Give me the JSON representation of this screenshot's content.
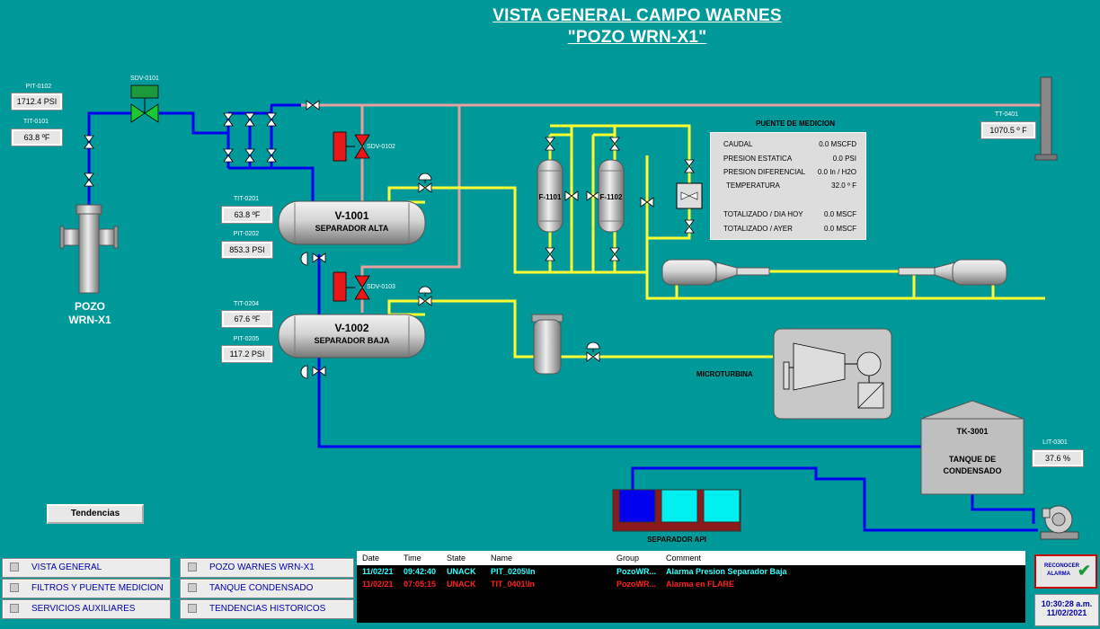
{
  "header": {
    "title_line1": "VISTA GENERAL CAMPO WARNES",
    "title_line2": "\"POZO WRN-X1\""
  },
  "instruments": {
    "pit_0102": {
      "tag": "PIT-0102",
      "value": "1712.4 PSI"
    },
    "tit_0101": {
      "tag": "TIT-0101",
      "value": "63.8 ºF"
    },
    "sdv_0101": {
      "tag": "SDV-0101"
    },
    "sdv_0102": {
      "tag": "SDV-0102"
    },
    "sdv_0103": {
      "tag": "SDV-0103"
    },
    "tit_0201": {
      "tag": "TIT-0201",
      "value": "63.8 ºF"
    },
    "pit_0202": {
      "tag": "PIT-0202",
      "value": "853.3 PSI"
    },
    "tit_0204": {
      "tag": "TIT-0204",
      "value": "67.6 ºF"
    },
    "pit_0205": {
      "tag": "PIT-0205",
      "value": "117.2 PSI"
    },
    "tt_0401": {
      "tag": "TT-0401",
      "value": "1070.5 º F"
    },
    "lit_0301": {
      "tag": "LIT-0301",
      "value": "37.6 %"
    }
  },
  "equipment": {
    "well": {
      "name": "POZO\nWRN-X1",
      "line1": "POZO",
      "line2": "WRN-X1"
    },
    "v1001": {
      "id": "V-1001",
      "name": "SEPARADOR ALTA"
    },
    "v1002": {
      "id": "V-1002",
      "name": "SEPARADOR BAJA"
    },
    "f1101": {
      "id": "F-1101"
    },
    "f1102": {
      "id": "F-1102"
    },
    "microturbine": {
      "name": "MICROTURBINA"
    },
    "tank": {
      "id": "TK-3001",
      "line1": "TANQUE DE",
      "line2": "CONDENSADO"
    },
    "api": {
      "name": "SEPARADOR API"
    }
  },
  "metering": {
    "title": "PUENTE DE MEDICION",
    "rows": [
      {
        "label": "CAUDAL",
        "value": "0.0 MSCFD"
      },
      {
        "label": "PRESION ESTATICA",
        "value": "0.0 PSI"
      },
      {
        "label": "PRESION DIFERENCIAL",
        "value": "0.0 In / H2O"
      },
      {
        "label": "TEMPERATURA",
        "value": "32.0 º F"
      },
      {
        "label": "TOTALIZADO / DIA HOY",
        "value": "0.0 MSCF"
      },
      {
        "label": "TOTALIZADO / AYER",
        "value": "0.0 MSCF"
      }
    ]
  },
  "buttons": {
    "trends": "Tendencias",
    "ack_line1": "RECONOCER",
    "ack_line2": "ALARMA"
  },
  "nav": {
    "left": [
      "VISTA GENERAL",
      "FILTROS Y PUENTE MEDICION",
      "SERVICIOS AUXILIARES"
    ],
    "right": [
      "POZO WARNES WRN-X1",
      "TANQUE CONDENSADO",
      "TENDENCIAS HISTORICOS"
    ]
  },
  "alarms": {
    "columns": [
      "Date",
      "Time",
      "State",
      "Name",
      "Group",
      "Comment"
    ],
    "rows": [
      {
        "date": "11/02/21",
        "time": "09:42:40",
        "state": "UNACK",
        "name": "PIT_0205\\In",
        "group": "PozoWR...",
        "comment": "Alarma Presion Separador Baja",
        "color": "#33ffff"
      },
      {
        "date": "11/02/21",
        "time": "07:05:15",
        "state": "UNACK",
        "name": "TIT_0401\\In",
        "group": "PozoWR...",
        "comment": "Alarma en FLARE",
        "color": "#ff2222"
      }
    ]
  },
  "clock": {
    "time": "10:30:28 a.m.",
    "date": "11/02/2021"
  },
  "colors": {
    "background": "#009999",
    "gas_line": "#ffff33",
    "liquid_line": "#0000ee",
    "flare_line": "#e6a0a0",
    "alarm_unack_warn": "#33ffff",
    "alarm_unack_crit": "#ff2222"
  }
}
